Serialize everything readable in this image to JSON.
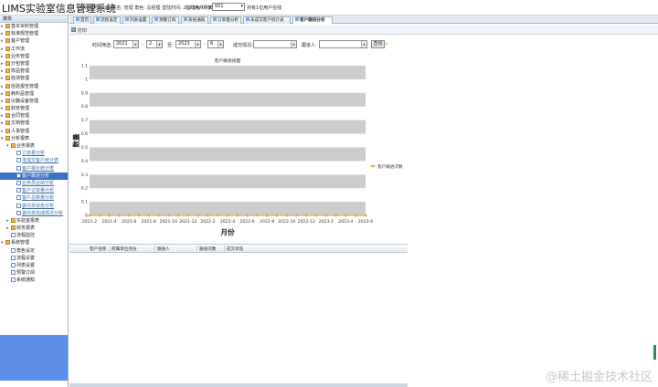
{
  "header": {
    "app_title": "LIMS实验室信息管理系统",
    "login_info": "登陆帐号: 001 姓名: 管理 角色: 总经理 登陆时间: 2023/6/10 9:05:37",
    "online_label": "在线用户列表",
    "online_selected": "001",
    "online_count": "共有1位用户在线"
  },
  "sidebar": {
    "header": "菜单",
    "items": [
      {
        "label": "基本资料管理",
        "level": 0,
        "icon": "folder-icon"
      },
      {
        "label": "标准规范管理",
        "level": 0,
        "icon": "folder-icon"
      },
      {
        "label": "客户管理",
        "level": 0,
        "icon": "folder-icon"
      },
      {
        "label": "工作流",
        "level": 0,
        "icon": "folder-icon"
      },
      {
        "label": "业务管理",
        "level": 0,
        "icon": "folder-icon"
      },
      {
        "label": "分包管理",
        "level": 0,
        "icon": "folder-icon"
      },
      {
        "label": "样品管理",
        "level": 0,
        "icon": "folder-icon"
      },
      {
        "label": "检测管理",
        "level": 0,
        "icon": "folder-icon"
      },
      {
        "label": "检验报告管理",
        "level": 0,
        "icon": "folder-icon"
      },
      {
        "label": "耗料品管理",
        "level": 0,
        "icon": "folder-icon"
      },
      {
        "label": "仪器设备管理",
        "level": 0,
        "icon": "folder-icon"
      },
      {
        "label": "财务管理",
        "level": 0,
        "icon": "folder-icon"
      },
      {
        "label": "合同管理",
        "level": 0,
        "icon": "folder-icon"
      },
      {
        "label": "文档管理",
        "level": 0,
        "icon": "folder-icon"
      },
      {
        "label": "人事管理",
        "level": 0,
        "icon": "folder-icon"
      },
      {
        "label": "分析报表",
        "level": 0,
        "icon": "folder-icon",
        "open": true
      },
      {
        "label": "业务报表",
        "level": 1,
        "icon": "folder-icon",
        "open": true
      },
      {
        "label": "订单量分析",
        "level": 2,
        "icon": "page-icon"
      },
      {
        "label": "未成交客户统计表",
        "level": 2,
        "icon": "page-icon"
      },
      {
        "label": "客户报价统计表",
        "level": 2,
        "icon": "page-icon"
      },
      {
        "label": "客户跟进分析",
        "level": 2,
        "icon": "page-icon",
        "selected": true
      },
      {
        "label": "业务员业绩分析",
        "level": 2,
        "icon": "page-icon"
      },
      {
        "label": "客户订单量分析",
        "level": 2,
        "icon": "page-icon"
      },
      {
        "label": "客户总数量分析",
        "level": 2,
        "icon": "page-icon"
      },
      {
        "label": "委托单状态分析",
        "level": 2,
        "icon": "page-icon"
      },
      {
        "label": "委托单完成情况分析",
        "level": 2,
        "icon": "page-icon"
      },
      {
        "label": "实验室报表",
        "level": 1,
        "icon": "folder-icon"
      },
      {
        "label": "财务报表",
        "level": 1,
        "icon": "folder-icon"
      },
      {
        "label": "流程监控",
        "level": 1,
        "icon": "page-icon"
      },
      {
        "label": "系统管理",
        "level": 0,
        "icon": "folder-icon",
        "open": true
      },
      {
        "label": "角色设定",
        "level": 1,
        "icon": "page-icon"
      },
      {
        "label": "流程设置",
        "level": 1,
        "icon": "page-icon"
      },
      {
        "label": "列表设置",
        "level": 1,
        "icon": "page-icon"
      },
      {
        "label": "预警订阅",
        "level": 1,
        "icon": "page-icon"
      },
      {
        "label": "系统通知",
        "level": 1,
        "icon": "page-icon"
      }
    ]
  },
  "tabs": [
    {
      "label": "首页",
      "active": false
    },
    {
      "label": "流程设定",
      "active": false
    },
    {
      "label": "列表设置",
      "active": false
    },
    {
      "label": "预警订阅",
      "active": false
    },
    {
      "label": "系统通知",
      "active": false
    },
    {
      "label": "订单量分析",
      "active": false
    },
    {
      "label": "未成交客户统计表",
      "active": false
    },
    {
      "label": "客户跟进分析",
      "active": true
    }
  ],
  "toolbar": {
    "print_label": "打印"
  },
  "query": {
    "time_label": "时间筛选:",
    "start_year": "2021",
    "start_month": "2",
    "to_label": "至:",
    "end_year": "2023",
    "end_month": "6",
    "dash": "-",
    "status_label": "成交情况:",
    "status_value": "",
    "follower_label": "跟进人:",
    "follower_value": "",
    "query_button": "查询"
  },
  "chart_data": {
    "type": "line",
    "title": "客户跟进视图",
    "xlabel": "月份",
    "ylabel": "数量",
    "ylim": [
      0,
      1.1
    ],
    "yticks": [
      "0",
      "0.1",
      "0.2",
      "0.3",
      "0.4",
      "0.5",
      "0.6",
      "0.7",
      "0.8",
      "0.9",
      "1",
      "1.1"
    ],
    "categories": [
      "2021-2",
      "2021-3",
      "2021-4",
      "2021-5",
      "2021-6",
      "2021-7",
      "2021-8",
      "2021-9",
      "2021-10",
      "2021-11",
      "2021-12",
      "2022-1",
      "2022-2",
      "2022-3",
      "2022-4",
      "2022-5",
      "2022-6",
      "2022-7",
      "2022-8",
      "2022-9",
      "2022-10",
      "2022-11",
      "2022-12",
      "2023-1",
      "2023-2",
      "2023-3",
      "2023-4",
      "2023-5",
      "2023-6"
    ],
    "xtick_labels": [
      "2021-2",
      "2021-4",
      "2021-6",
      "2021-8",
      "2021-10",
      "2021-12",
      "2022-2",
      "2022-4",
      "2022-6",
      "2022-8",
      "2022-10",
      "2022-12",
      "2023-2",
      "2023-4",
      "2023-6"
    ],
    "series": [
      {
        "name": "客户跟进次数",
        "values": [
          0,
          0,
          0,
          0,
          0,
          0,
          0,
          0,
          0,
          0,
          0,
          0,
          0,
          0,
          0,
          0,
          0,
          0,
          0,
          0,
          0,
          0,
          0,
          0,
          0,
          0,
          0,
          0,
          0
        ]
      }
    ],
    "grid": "alternating bands",
    "legend": "right",
    "colors": {
      "series": "#e6a23c",
      "band": "#cccccc"
    }
  },
  "table": {
    "columns": [
      "客户名称",
      "所属单位月份",
      "跟进人",
      "跟进次数",
      "成交状态"
    ],
    "rows": []
  },
  "watermark": "@稀土掘金技术社区"
}
